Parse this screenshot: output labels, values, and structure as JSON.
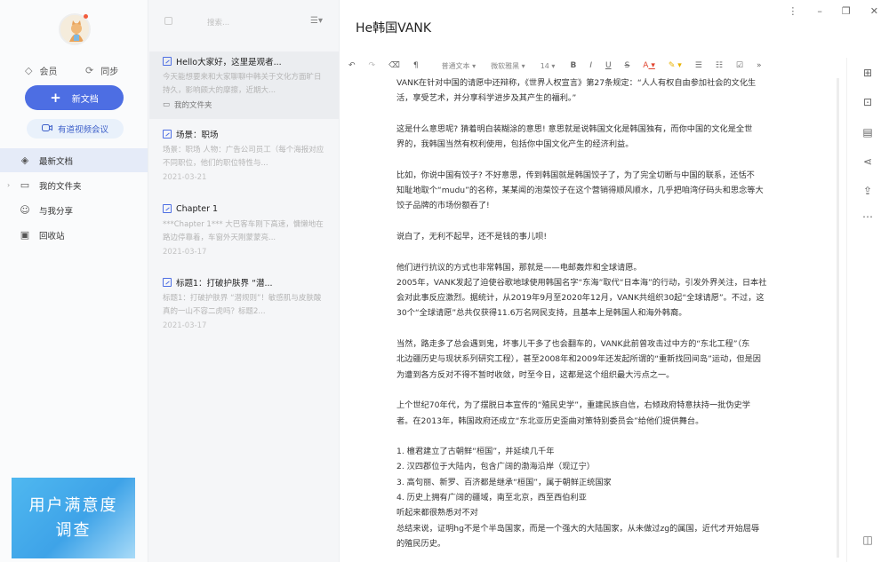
{
  "window": {
    "title": "He韩国VANK"
  },
  "account": {
    "member_label": "会员",
    "sync_label": "同步"
  },
  "actions": {
    "new_doc_label": "新文档",
    "video_meeting_label": "有道视频会议"
  },
  "nav": {
    "items": [
      {
        "label": "最新文档",
        "icon": "clock-icon"
      },
      {
        "label": "我的文件夹",
        "icon": "folder-icon"
      },
      {
        "label": "与我分享",
        "icon": "share-users-icon"
      },
      {
        "label": "回收站",
        "icon": "trash-icon"
      }
    ]
  },
  "banner": {
    "line1": "用户满意度",
    "line2": "调查"
  },
  "list": {
    "search_placeholder": "搜索...",
    "notes": [
      {
        "title": "Hello大家好，这里是观者...",
        "snippet": "今天能想要来和大家聊聊中韩关于文化方面旷日持久，影响颇大的摩擦，近期大...",
        "folder": "我的文件夹"
      },
      {
        "title": "场景：职场",
        "snippet": "场景：职场 人物：广告公司员工（每个海报对应不同职位，他们的职位特性与...",
        "date": "2021-03-21"
      },
      {
        "title": "Chapter 1",
        "snippet": "***Chapter 1*** 大巴客车刚下高速，慵懒地在路边停靠着，车窗外天刚蒙蒙亮...",
        "date": "2021-03-17"
      },
      {
        "title": "标题1：打破护肤界 “潜...",
        "snippet": "标题1：打破护肤界 “潜规则”！敏感肌与皮肤酸真的一山不容二虎吗？标题2...",
        "date": "2021-03-17"
      }
    ]
  },
  "toolbar": {
    "font_style": "普通文本",
    "font_family": "微软雅黑",
    "font_size": "14",
    "bold": "B",
    "italic": "I",
    "underline": "U",
    "strike": "S",
    "font_color": "A",
    "more": "»"
  },
  "content": {
    "paragraphs": [
      [
        "VANK在针对中国的请愿中还辩称，《世界人权宣言》第27条规定：“人人有权自由参加社会的文化生",
        "活，享受艺术，并分享科学进步及其产生的福利。”"
      ],
      [
        "这是什么意思呢? 猜着明白装糊涂的意思! 意思就是说韩国文化是韩国独有，而你中国的文化是全世",
        "界的，我韩国当然有权利使用，包括你中国文化产生的经济利益。"
      ],
      [
        "比如，你说中国有饺子? 不好意思，传到韩国就是韩国饺子了，为了完全切断与中国的联系，还恬不",
        "知耻地取个“mudu”的名称，某某闻的泡菜饺子在这个营销得顺风顺水，几乎把咱湾仔码头和思念等大",
        "饺子品牌的市场份额吞了!"
      ],
      [
        "说白了，无利不起早，还不是钱的事儿呗!"
      ],
      [
        "他们进行抗议的方式也非常韩国，那就是——电邮轰炸和全球请愿。",
        "2005年，VANK发起了迫使谷歌地球使用韩国名字“东海”取代“日本海”的行动，引发外界关注，日本社",
        "会对此事反应激烈。据统计，从2019年9月至2020年12月，VANK共组织30起“全球请愿”。不过，这",
        "30个“全球请愿”总共仅获得11.6万名网民支持，且基本上是韩国人和海外韩裔。"
      ],
      [
        "当然，路走多了总会遇到鬼，坏事儿干多了也会翻车的，VANK此前曾攻击过中方的“东北工程”（东",
        "北边疆历史与现状系列研究工程），甚至2008年和2009年还发起所谓的“重新找回间岛”运动，但是因",
        "为遭到各方反对不得不暂时收敛，时至今日，这都是这个组织最大污点之一。"
      ],
      [
        "上个世纪70年代，为了摆脱日本宣传的“殖民史学”，重建民族自信，右倾政府特意扶持一批伪史学",
        "者。在2013年，韩国政府还成立“东北亚历史歪曲对策特别委员会”给他们提供舞台。"
      ],
      [
        "1. 檀君建立了古朝鲜“桓国”，并延续几千年",
        "2. 汉四郡位于大陆内，包含广阔的渤海沿岸（现辽宁）",
        "3. 高句丽、新罗、百济都是继承“桓国”，属于朝鲜正统国家",
        "4. 历史上拥有广阔的疆域，南至北京，西至西伯利亚",
        "听起来都很熟悉对不对",
        "总结来说，证明hg不是个半岛国家，而是一个强大的大陆国家，从未做过zg的属国，近代才开始屈辱",
        "的殖民历史。"
      ]
    ]
  }
}
